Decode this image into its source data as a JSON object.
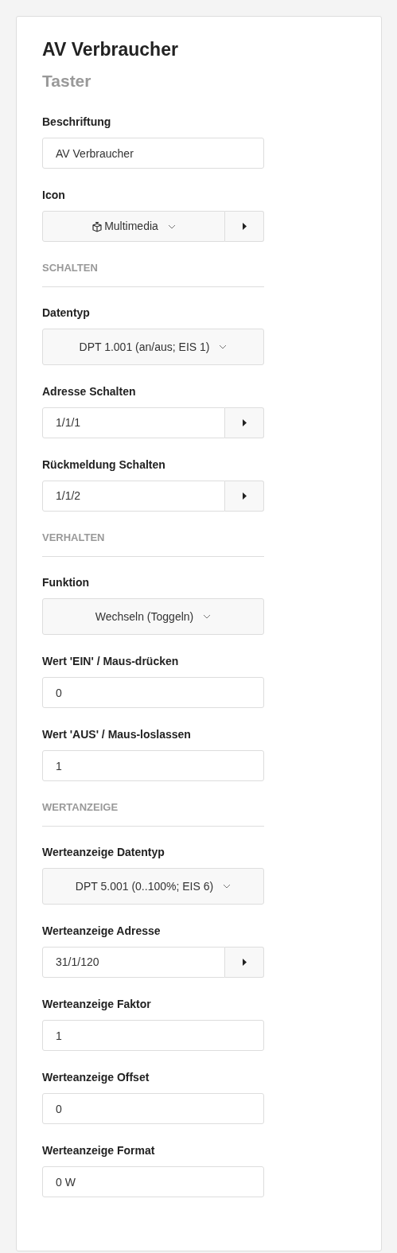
{
  "title": "AV Verbraucher",
  "subtitle": "Taster",
  "fields": [
    {
      "kind": "text",
      "label": "Beschriftung",
      "value": "AV Verbraucher"
    },
    {
      "kind": "icon-select",
      "label": "Icon",
      "value": "Multimedia"
    },
    {
      "kind": "section",
      "label": "SCHALTEN"
    },
    {
      "kind": "select",
      "label": "Datentyp",
      "value": "DPT 1.001 (an/aus; EIS 1)"
    },
    {
      "kind": "address",
      "label": "Adresse Schalten",
      "value": "1/1/1"
    },
    {
      "kind": "address",
      "label": "Rückmeldung Schalten",
      "value": "1/1/2"
    },
    {
      "kind": "section",
      "label": "VERHALTEN"
    },
    {
      "kind": "select",
      "label": "Funktion",
      "value": "Wechseln (Toggeln)"
    },
    {
      "kind": "text",
      "label": "Wert 'EIN' / Maus-drücken",
      "value": "0"
    },
    {
      "kind": "text",
      "label": "Wert 'AUS' / Maus-loslassen",
      "value": "1"
    },
    {
      "kind": "section",
      "label": "WERTANZEIGE"
    },
    {
      "kind": "select",
      "label": "Werteanzeige Datentyp",
      "value": "DPT 5.001 (0..100%; EIS 6)"
    },
    {
      "kind": "address",
      "label": "Werteanzeige Adresse",
      "value": "31/1/120"
    },
    {
      "kind": "text",
      "label": "Werteanzeige Faktor",
      "value": "1"
    },
    {
      "kind": "text",
      "label": "Werteanzeige Offset",
      "value": "0"
    },
    {
      "kind": "text",
      "label": "Werteanzeige Format",
      "value": "0 W"
    }
  ]
}
